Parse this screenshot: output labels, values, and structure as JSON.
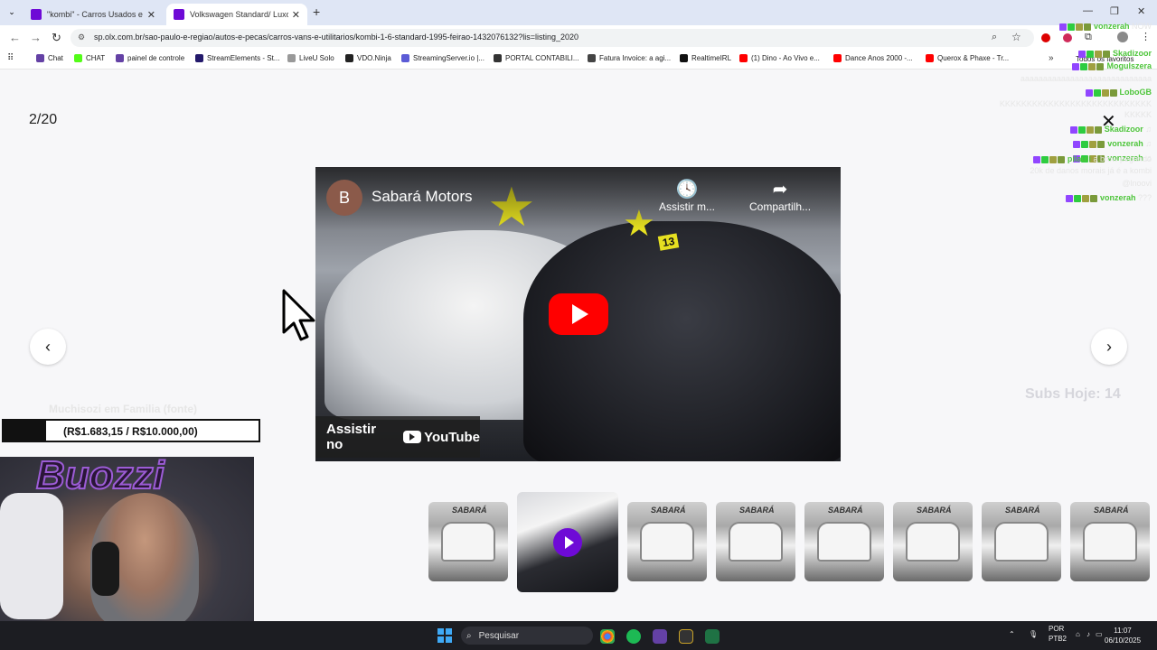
{
  "browser": {
    "tabs": [
      {
        "title": "\"kombi\" - Carros Usados e Nov",
        "active": false
      },
      {
        "title": "Volkswagen Standard/ Luxo/ Se",
        "active": true
      }
    ],
    "url": "sp.olx.com.br/sao-paulo-e-regiao/autos-e-pecas/carros-vans-e-utilitarios/kombi-1-6-standard-1995-feirao-1432076132?lis=listing_2020",
    "bookmarks": [
      {
        "label": "Chat",
        "color": "#6441a5"
      },
      {
        "label": "CHAT",
        "color": "#53fc18"
      },
      {
        "label": "painel de controle",
        "color": "#6441a5"
      },
      {
        "label": "StreamElements - St...",
        "color": "#23196b"
      },
      {
        "label": "LiveU Solo",
        "color": "#999999"
      },
      {
        "label": "VDO.Ninja",
        "color": "#222222"
      },
      {
        "label": "StreamingServer.io |...",
        "color": "#5b5bd6"
      },
      {
        "label": "PORTAL CONTABILI...",
        "color": "#333333"
      },
      {
        "label": "Fatura Invoice: a agi...",
        "color": "#444444"
      },
      {
        "label": "RealtimeIRL",
        "color": "#111111"
      },
      {
        "label": "(1) Dino - Ao Vivo e...",
        "color": "#ff0000"
      },
      {
        "label": "Dance Anos 2000 -...",
        "color": "#ff0000"
      },
      {
        "label": "Querox & Phaxe - Tr...",
        "color": "#ff0000"
      }
    ],
    "all_favorites": "Todos os favoritos"
  },
  "gallery": {
    "counter": "2/20",
    "close_icon": "close-icon",
    "video": {
      "channel_initial": "B",
      "channel_name": "Sabará Motors",
      "watch_later": "Assistir m...",
      "share": "Compartilh...",
      "watch_on": "Assistir no",
      "youtube": "YouTube",
      "plate_number": "13"
    },
    "thumbnail_logo": "SABARÁ",
    "thumbnail_count": 8,
    "active_thumbnail": 2
  },
  "overlay": {
    "goal_title": "Muchisozi em Familia (fonte)",
    "goal_text": "(R$1.683,15 / R$10.000,00)",
    "goal_progress": 0.168,
    "subs_today": "Subs Hoje: 14",
    "webcam_sign": "Buozzi"
  },
  "chat": [
    {
      "user": "vonzerah",
      "text": "NOW"
    },
    {
      "user": "Skadizoor",
      "text": ""
    },
    {
      "user": "Mogulszera",
      "text": ""
    },
    {
      "user": "",
      "text": "aaaaaaaaaaaaaaaaaaaaaaaaaaaaa"
    },
    {
      "user": "LoboGB",
      "text": ""
    },
    {
      "user": "",
      "text": "KKKKKKKKKKKKKKKKKKKKKKKKKKKK"
    },
    {
      "user": "",
      "text": "KKKKK"
    },
    {
      "user": "Skadizoor",
      "text": "♫"
    },
    {
      "user": "vonzerah",
      "text": "♫"
    },
    {
      "user": "vonzerah",
      "text": "♫"
    },
    {
      "user": "pilauli",
      "text": "a brow pegando"
    },
    {
      "user": "",
      "text": "20k de danos morais já é a kombi"
    },
    {
      "user": "",
      "text": "@lnoovi"
    },
    {
      "user": "vonzerah",
      "text": "???"
    }
  ],
  "taskbar": {
    "search_placeholder": "Pesquisar",
    "lang": "POR",
    "kbd": "PTB2",
    "time": "11:07",
    "date": "06/10/2025"
  }
}
